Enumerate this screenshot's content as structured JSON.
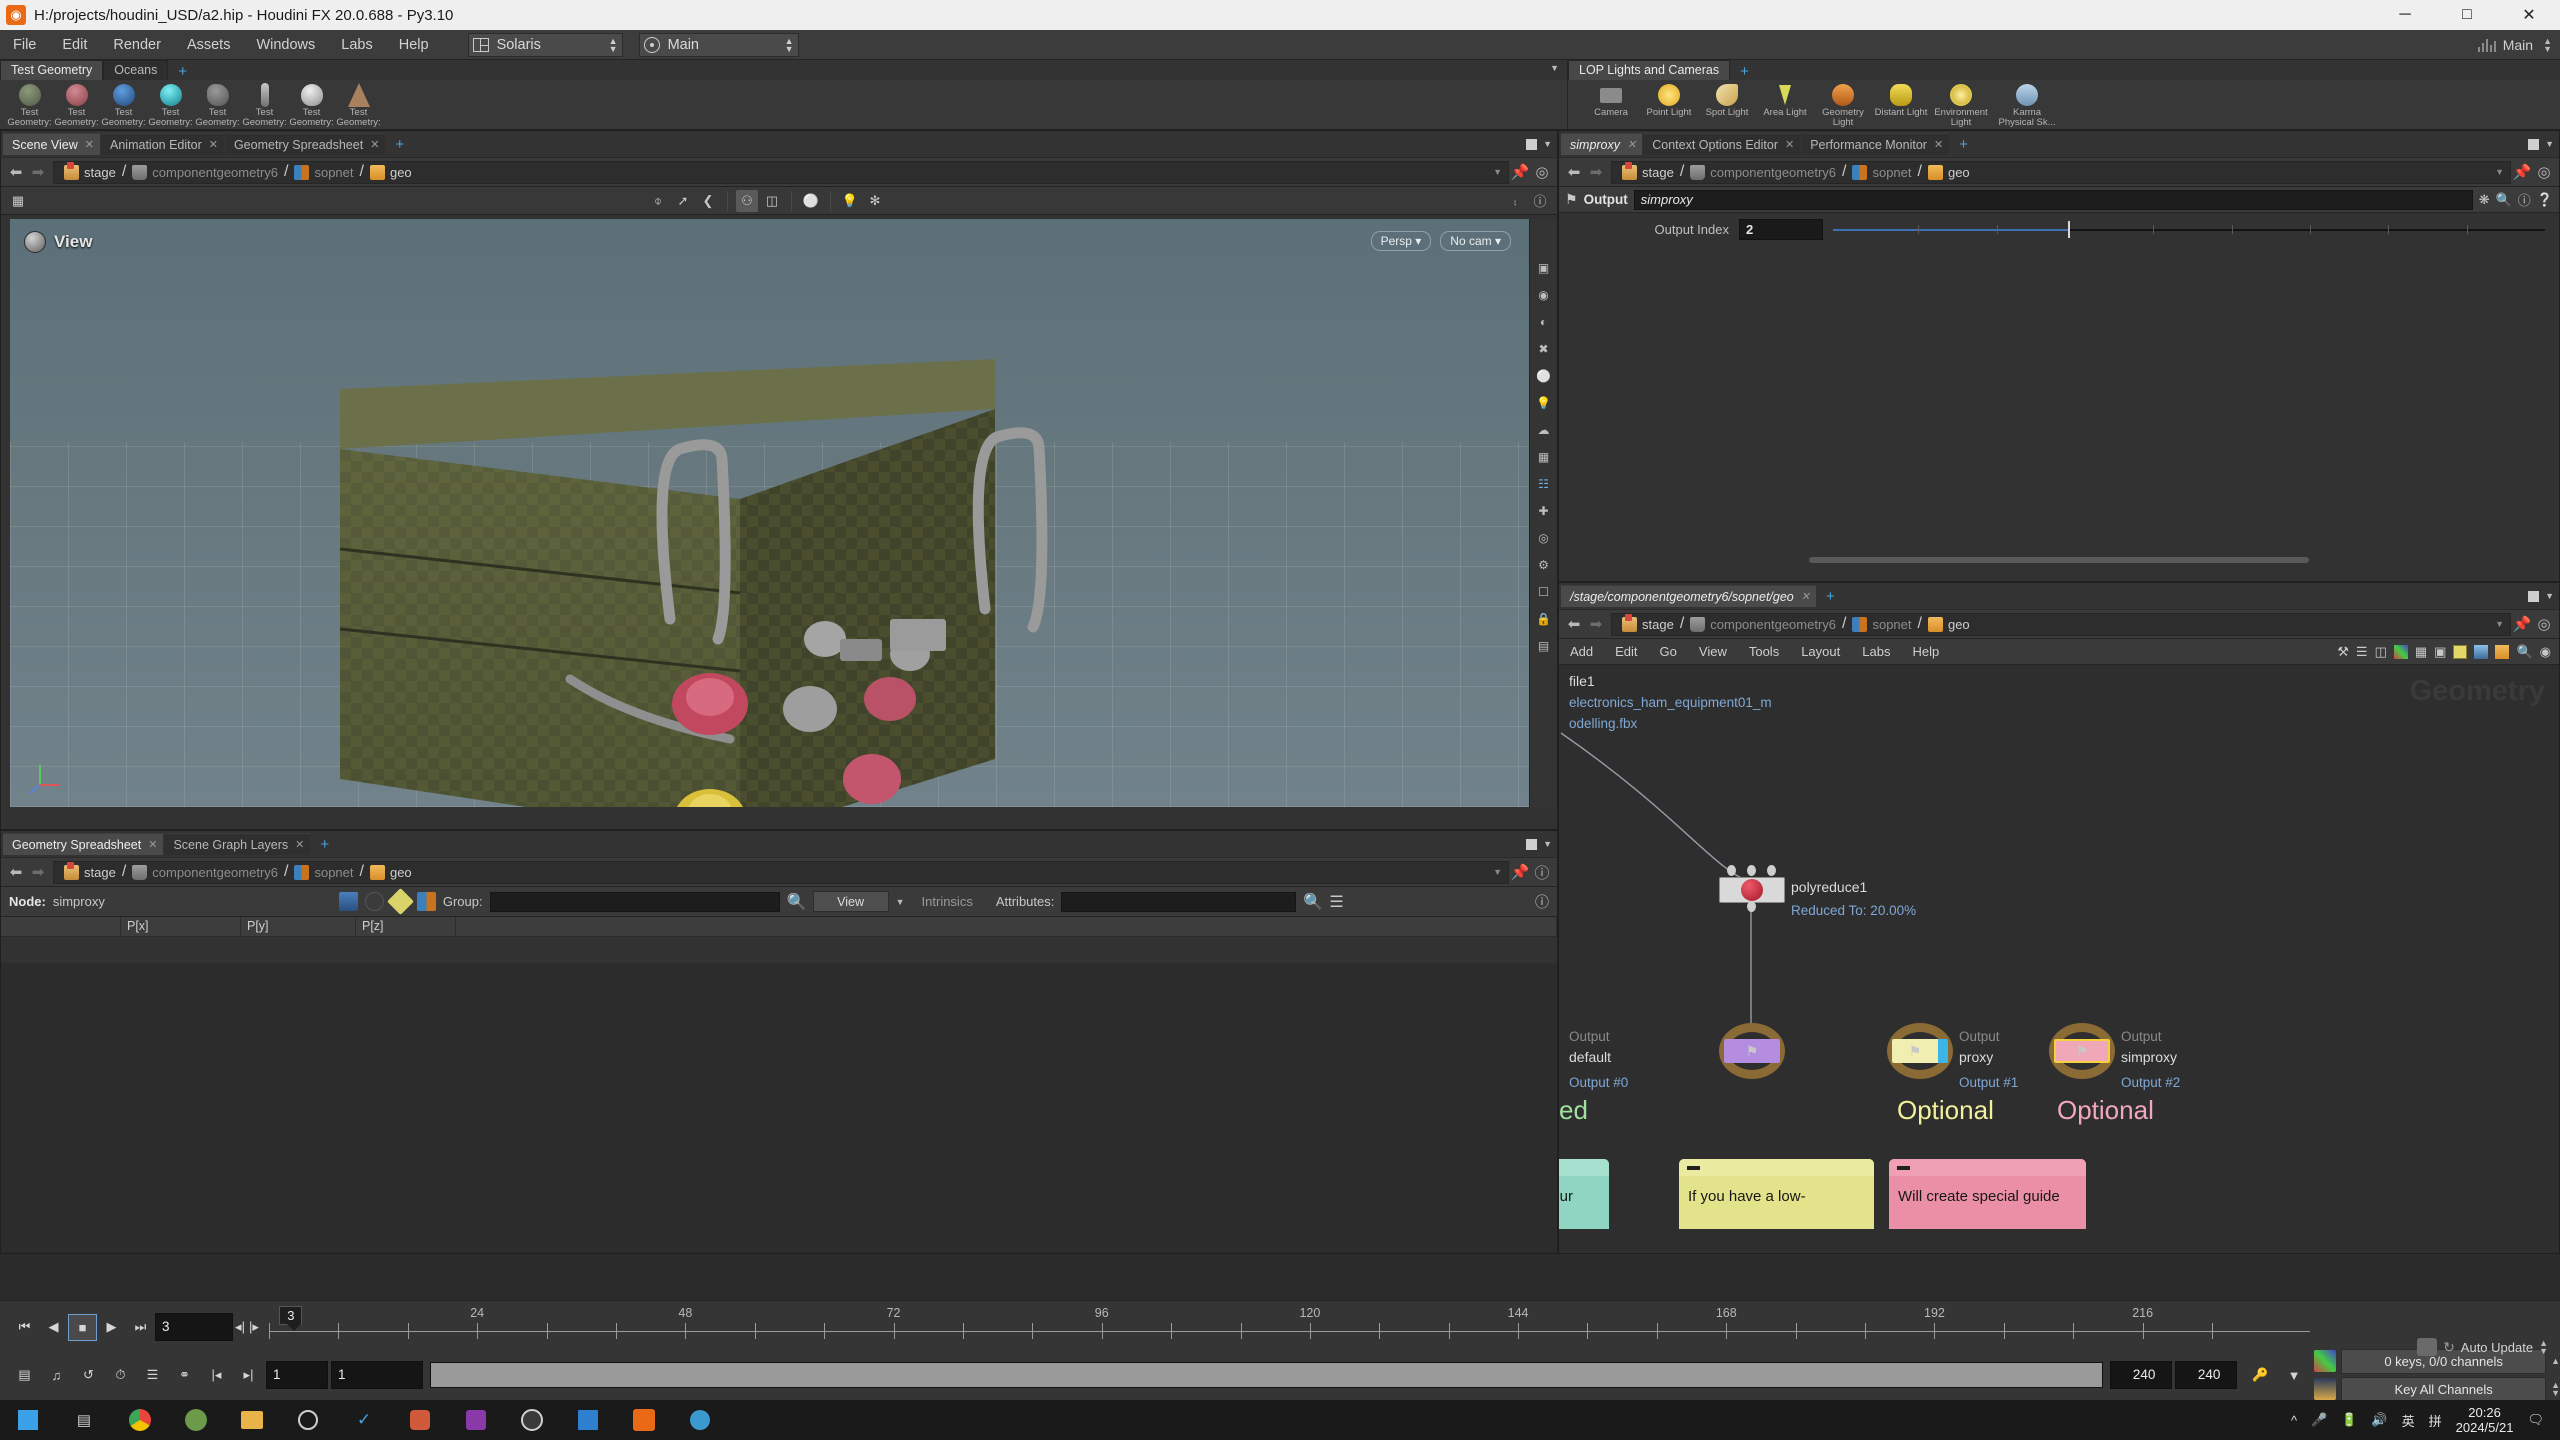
{
  "window": {
    "title": "H:/projects/houdini_USD/a2.hip - Houdini FX 20.0.688 - Py3.10",
    "app_icon": "houdini-logo-icon",
    "minimize": "─",
    "maximize": "□",
    "close": "✕"
  },
  "menubar": {
    "items": [
      "File",
      "Edit",
      "Render",
      "Assets",
      "Windows",
      "Labs",
      "Help"
    ],
    "desktop": "Solaris",
    "mode": "Main",
    "right_label": "Main"
  },
  "shelf": {
    "left_tabs": [
      {
        "label": "Test Geometry",
        "active": true
      },
      {
        "label": "Oceans",
        "active": false
      }
    ],
    "plus": "+",
    "left_items": [
      {
        "label1": "Test",
        "label2": "Geometry:",
        "color": "#6f7a63"
      },
      {
        "label1": "Test",
        "label2": "Geometry:",
        "color": "#b4606a"
      },
      {
        "label1": "Test",
        "label2": "Geometry:",
        "color": "#3d6fae"
      },
      {
        "label1": "Test",
        "label2": "Geometry:",
        "color": "#2fbfc8"
      },
      {
        "label1": "Test",
        "label2": "Geometry:",
        "color": "#7d7d7d"
      },
      {
        "label1": "Test",
        "label2": "Geometry:",
        "color": "#9a9a9a"
      },
      {
        "label1": "Test",
        "label2": "Geometry:",
        "color": "#cfcfcf"
      },
      {
        "label1": "Test",
        "label2": "Geometry:",
        "color": "#9c7a5c"
      }
    ],
    "right_tabs": [
      {
        "label": "LOP Lights and Cameras",
        "active": true
      }
    ],
    "right_items": [
      {
        "label1": "Camera",
        "label2": "",
        "color": "#8b8b8b"
      },
      {
        "label1": "Point Light",
        "label2": "",
        "color": "#f0c83c"
      },
      {
        "label1": "Spot Light",
        "label2": "",
        "color": "#e8d7a0"
      },
      {
        "label1": "Area Light",
        "label2": "",
        "color": "#d8d85a"
      },
      {
        "label1": "Geometry",
        "label2": "Light",
        "color": "#e08a3c"
      },
      {
        "label1": "Distant Light",
        "label2": "",
        "color": "#e8d34a"
      },
      {
        "label1": "Environment",
        "label2": "Light",
        "color": "#e4c33a"
      },
      {
        "label1": "Karma",
        "label2": "Physical Sk...",
        "color": "#bcd3e8"
      }
    ]
  },
  "scene_view_pane": {
    "tabs": [
      {
        "label": "Scene View",
        "active": true,
        "close": "✕"
      },
      {
        "label": "Animation Editor",
        "active": false,
        "close": "✕"
      },
      {
        "label": "Geometry Spreadsheet",
        "active": false,
        "close": "✕"
      }
    ],
    "plus": "+",
    "breadcrumb": [
      {
        "label": "stage",
        "icon": "stage-icon",
        "dim": false
      },
      {
        "label": "componentgeometry6",
        "icon": "componentgeometry-icon",
        "dim": true
      },
      {
        "label": "sopnet",
        "icon": "sopnet-icon",
        "dim": true
      },
      {
        "label": "geo",
        "icon": "geo-icon",
        "dim": false
      }
    ],
    "viewport": {
      "label": "View",
      "badges": [
        "Persp ▾",
        "No cam ▾"
      ]
    }
  },
  "geometry_spreadsheet": {
    "tabs": [
      {
        "label": "Geometry Spreadsheet",
        "active": true,
        "close": "✕"
      },
      {
        "label": "Scene Graph Layers",
        "active": false,
        "close": "✕"
      }
    ],
    "plus": "+",
    "breadcrumb": [
      {
        "label": "stage",
        "dim": false
      },
      {
        "label": "componentgeometry6",
        "dim": true
      },
      {
        "label": "sopnet",
        "dim": true
      },
      {
        "label": "geo",
        "dim": false
      }
    ],
    "node_label": "Node:",
    "node_value": "simproxy",
    "group_label": "Group:",
    "group_value": "",
    "view_button": "View",
    "intrinsics_label": "Intrinsics",
    "attributes_label": "Attributes:",
    "attributes_value": "",
    "columns": [
      "",
      "P[x]",
      "P[y]",
      "P[z]",
      ""
    ],
    "rows": []
  },
  "parameter_pane": {
    "tabs": [
      {
        "label": "simproxy",
        "active": true,
        "close": "✕"
      },
      {
        "label": "Context Options Editor",
        "active": false,
        "close": "✕"
      },
      {
        "label": "Performance Monitor",
        "active": false,
        "close": "✕"
      }
    ],
    "plus": "+",
    "breadcrumb": [
      {
        "label": "stage",
        "dim": false
      },
      {
        "label": "componentgeometry6",
        "dim": true
      },
      {
        "label": "sopnet",
        "dim": true
      },
      {
        "label": "geo",
        "dim": false
      }
    ],
    "output_label": "Output",
    "output_value": "simproxy",
    "params": [
      {
        "label": "Output Index",
        "value": "2",
        "slider_pct": 33
      }
    ],
    "icons": [
      "gear-icon",
      "search-icon",
      "info-icon",
      "help-icon"
    ]
  },
  "network_editor": {
    "tabs": [
      {
        "label": "/stage/componentgeometry6/sopnet/geo",
        "active": true,
        "close": "✕"
      }
    ],
    "plus": "+",
    "breadcrumb": [
      {
        "label": "stage",
        "dim": false
      },
      {
        "label": "componentgeometry6",
        "dim": true
      },
      {
        "label": "sopnet",
        "dim": true
      },
      {
        "label": "geo",
        "dim": false
      }
    ],
    "menu": [
      "Add",
      "Edit",
      "Go",
      "View",
      "Tools",
      "Layout",
      "Labs",
      "Help"
    ],
    "watermark": "Geometry",
    "nodes": [
      {
        "name": "file1",
        "sub1": "electronics_ham_equipment01_m",
        "sub2": "odelling.fbx"
      },
      {
        "name": "polyreduce1",
        "sub1": "Reduced To: 20.00%"
      }
    ],
    "outputs": [
      {
        "kind": "Output",
        "name": "default",
        "index": "Output #0",
        "chip": "#cfcfcf",
        "word": "ed",
        "word_color": "#9fe09f"
      },
      {
        "kind": "Output",
        "name": "proxy",
        "index": "Output #1",
        "chip": "#f0eeb0",
        "word": "Optional",
        "word_color": "#f2f09a"
      },
      {
        "kind": "Output",
        "name": "simproxy",
        "index": "Output #2",
        "chip": "#f0a8b8",
        "word": "Optional",
        "word_color": "#f2a8bc"
      }
    ],
    "stickies": [
      {
        "text": "ct your",
        "color": "#8fd5c2",
        "bar": "#a8e0d0"
      },
      {
        "text": "If you have a low-",
        "color": "#e3e38b",
        "bar": "#eaeaa0"
      },
      {
        "text": "Will create special guide",
        "color": "#eb8fa6",
        "bar": "#f0a0b4"
      }
    ]
  },
  "playbar": {
    "transport": [
      "⏮",
      "◀",
      "■",
      "▶",
      "⏭"
    ],
    "current_frame": "3",
    "playhead_label": "3",
    "ticks": [
      24,
      48,
      72,
      96,
      120,
      144,
      168,
      192,
      216
    ],
    "range_start": "1",
    "range_start2": "1",
    "range_end": "240",
    "range_end2": "240",
    "keys_status": "0 keys, 0/0 channels",
    "key_mode": "Key All Channels",
    "auto_update": "Auto Update"
  },
  "taskbar": {
    "time": "20:26",
    "date": "2024/5/21",
    "ime": [
      "英",
      "拼"
    ]
  }
}
